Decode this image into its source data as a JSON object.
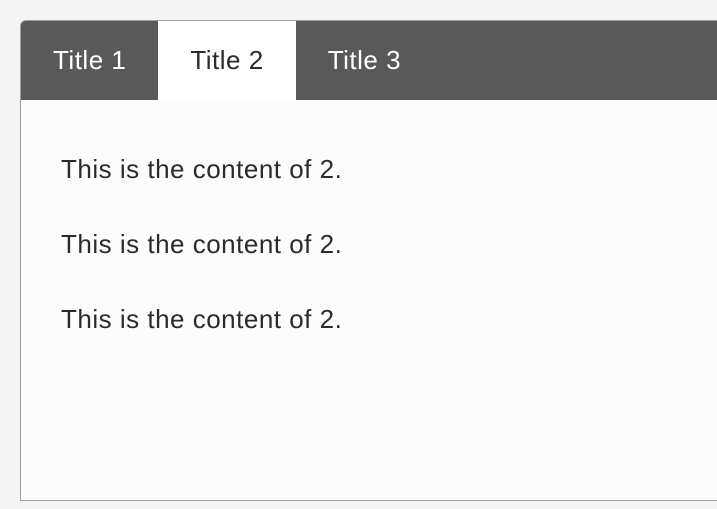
{
  "tabs": [
    {
      "label": "Title 1",
      "active": false
    },
    {
      "label": "Title 2",
      "active": true
    },
    {
      "label": "Title 3",
      "active": false
    }
  ],
  "content": {
    "lines": [
      "This is the content of 2.",
      "This is the content of 2.",
      "This is the content of 2."
    ]
  }
}
